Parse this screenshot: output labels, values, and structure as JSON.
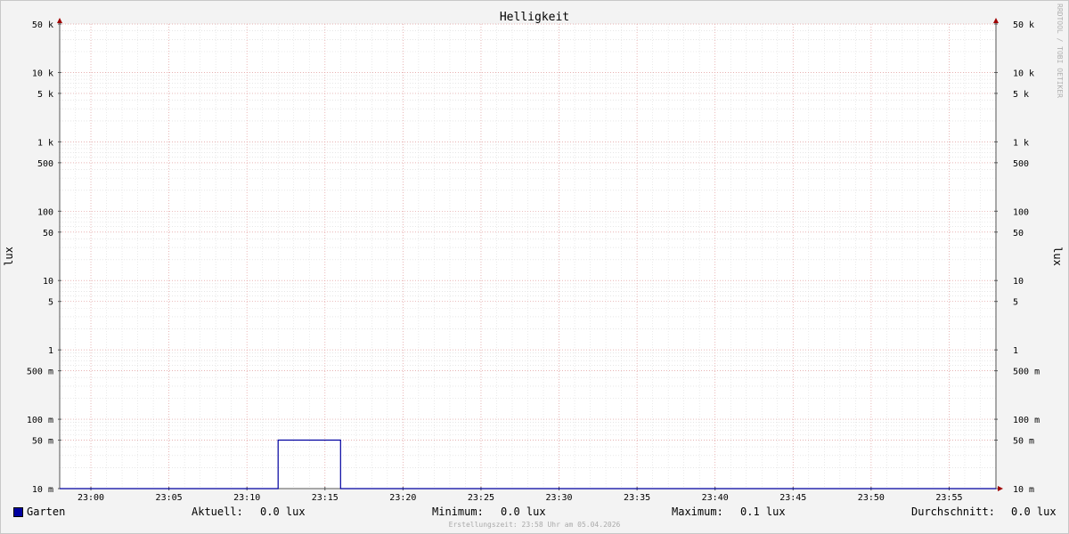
{
  "chart_data": {
    "type": "area",
    "title": "Helligkeit",
    "ylabel_left": "lux",
    "ylabel_right": "lux",
    "y_scale": "log",
    "ylim": [
      0.01,
      50000
    ],
    "xlim": [
      "22:58",
      "23:58"
    ],
    "y_ticks": [
      {
        "value": 50000,
        "label": "50 k"
      },
      {
        "value": 10000,
        "label": "10 k"
      },
      {
        "value": 5000,
        "label": "5 k"
      },
      {
        "value": 1000,
        "label": "1 k"
      },
      {
        "value": 500,
        "label": "500"
      },
      {
        "value": 100,
        "label": "100"
      },
      {
        "value": 50,
        "label": "50"
      },
      {
        "value": 10,
        "label": "10"
      },
      {
        "value": 5,
        "label": "5"
      },
      {
        "value": 1,
        "label": "1"
      },
      {
        "value": 0.5,
        "label": "500 m"
      },
      {
        "value": 0.1,
        "label": "100 m"
      },
      {
        "value": 0.05,
        "label": "50 m"
      },
      {
        "value": 0.01,
        "label": "10 m"
      }
    ],
    "x_ticks": [
      "23:00",
      "23:05",
      "23:10",
      "23:15",
      "23:20",
      "23:25",
      "23:30",
      "23:35",
      "23:40",
      "23:45",
      "23:50",
      "23:55"
    ],
    "grid": true,
    "series": [
      {
        "name": "Garten",
        "color": "#0000a0",
        "points": [
          {
            "x": "22:58",
            "y": 0.01
          },
          {
            "x": "23:12",
            "y": 0.01
          },
          {
            "x": "23:12",
            "y": 0.05
          },
          {
            "x": "23:16",
            "y": 0.05
          },
          {
            "x": "23:16",
            "y": 0.01
          },
          {
            "x": "23:58",
            "y": 0.01
          }
        ]
      }
    ]
  },
  "legend": {
    "series_name": "Garten",
    "aktuell_label": "Aktuell:",
    "aktuell_value": "0.0 lux",
    "minimum_label": "Minimum:",
    "minimum_value": "0.0 lux",
    "maximum_label": "Maximum:",
    "maximum_value": "0.1 lux",
    "durchschnitt_label": "Durchschnitt:",
    "durchschnitt_value": "0.0 lux"
  },
  "footer": "Erstellungszeit: 23:58 Uhr am 05.04.2026",
  "watermark": "RRDTOOL / TOBI OETIKER"
}
